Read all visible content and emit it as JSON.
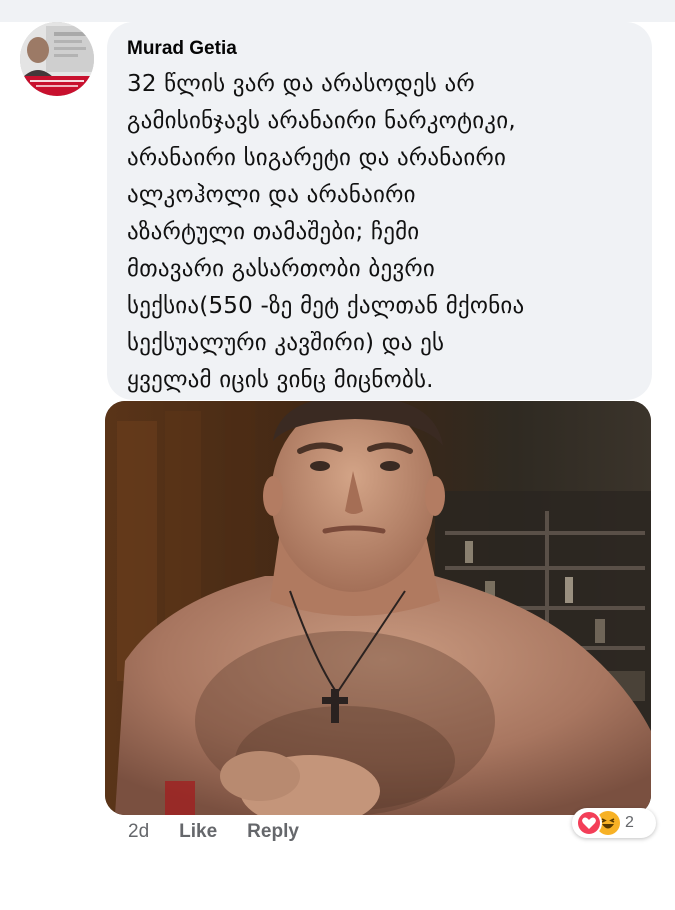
{
  "comment": {
    "author": "Murad Getia",
    "text": "32 წლის ვარ და არასოდეს არ\nგამისინჯავს არანაირი ნარკოტიკი,\nარანაირი სიგარეტი და არანაირი\nალკოჰოლი და არანაირი\nაზარტული თამაშები; ჩემი\nმთავარი გასართობი ბევრი\nსექსია(550 -ზე მეტ ქალთან მქონია\nსექსუალური კავშირი)  და ეს\nყველამ იცის ვინც მიცნობს.",
    "time": "2d",
    "like_label": "Like",
    "reply_label": "Reply",
    "reactions": {
      "icons": [
        "love-reaction-icon",
        "haha-reaction-icon"
      ],
      "count": "2"
    }
  },
  "colors": {
    "bubble": "#f0f2f5",
    "muted_text": "#65676b",
    "love": "#f33e58",
    "haha": "#f7b125"
  }
}
